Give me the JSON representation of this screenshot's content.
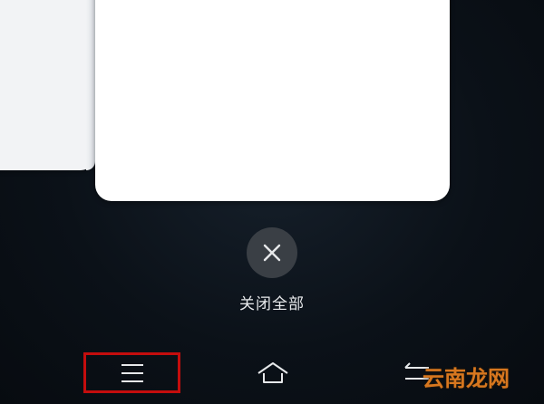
{
  "recents": {
    "close_all_label": "关闭全部"
  },
  "nav": {
    "menu_icon": "menu-icon",
    "home_icon": "home-icon",
    "back_icon": "back-icon",
    "highlight_color": "#c40d0d"
  },
  "watermark": {
    "text": "云南龙网"
  },
  "colors": {
    "background": "#0b1118",
    "card": "#ffffff",
    "close_button": "#3a3f45",
    "watermark": "#d7771f"
  }
}
